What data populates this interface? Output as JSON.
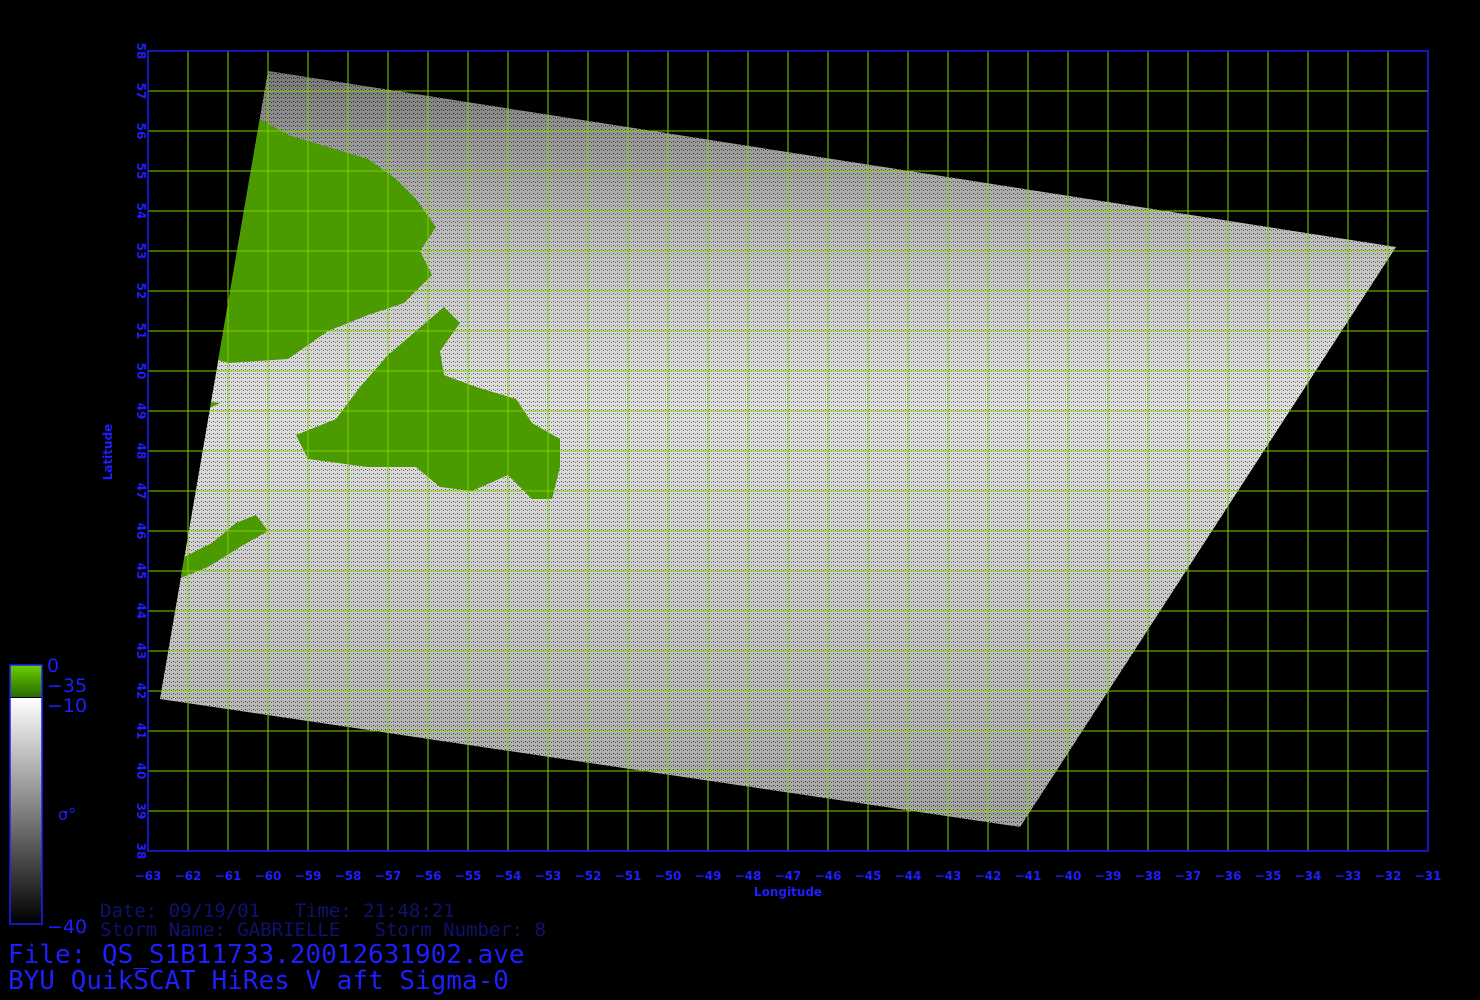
{
  "chart_data": {
    "type": "heatmap",
    "xlabel": "Longitude",
    "ylabel": "Latitude",
    "xlim": [
      -63,
      -31
    ],
    "ylim": [
      38,
      58
    ],
    "x_ticks": [
      -63,
      -62,
      -61,
      -60,
      -59,
      -58,
      -57,
      -56,
      -55,
      -54,
      -53,
      -52,
      -51,
      -50,
      -49,
      -48,
      -47,
      -46,
      -45,
      -44,
      -43,
      -42,
      -41,
      -40,
      -39,
      -38,
      -37,
      -36,
      -35,
      -34,
      -33,
      -32,
      -31
    ],
    "y_ticks": [
      38,
      39,
      40,
      41,
      42,
      43,
      44,
      45,
      46,
      47,
      48,
      49,
      50,
      51,
      52,
      53,
      54,
      55,
      56,
      57,
      58
    ],
    "grid": true,
    "swath_corners": [
      [
        -60.0,
        57.5
      ],
      [
        -31.8,
        53.1
      ],
      [
        -41.2,
        38.6
      ],
      [
        -62.7,
        41.8
      ]
    ],
    "colorbar": {
      "labels": [
        "0",
        "−35",
        "−10",
        "σ°",
        "−40"
      ],
      "land_color": "#4a9a00",
      "ocean_colors": [
        "#ffffff",
        "#000000"
      ]
    }
  },
  "colors": {
    "grid": "#7fd000",
    "axis": "#1e1eff",
    "land": "#4a9a00",
    "text_dark": "#101070"
  },
  "info": {
    "date_line": "Date: 09/19/01   Time: 21:48:21",
    "storm_line": "Storm Name: GABRIELLE   Storm Number: 8",
    "file_line": "File: QS_S1B11733.20012631902.ave",
    "title_line": "BYU QuikSCAT HiRes V aft Sigma-0"
  }
}
